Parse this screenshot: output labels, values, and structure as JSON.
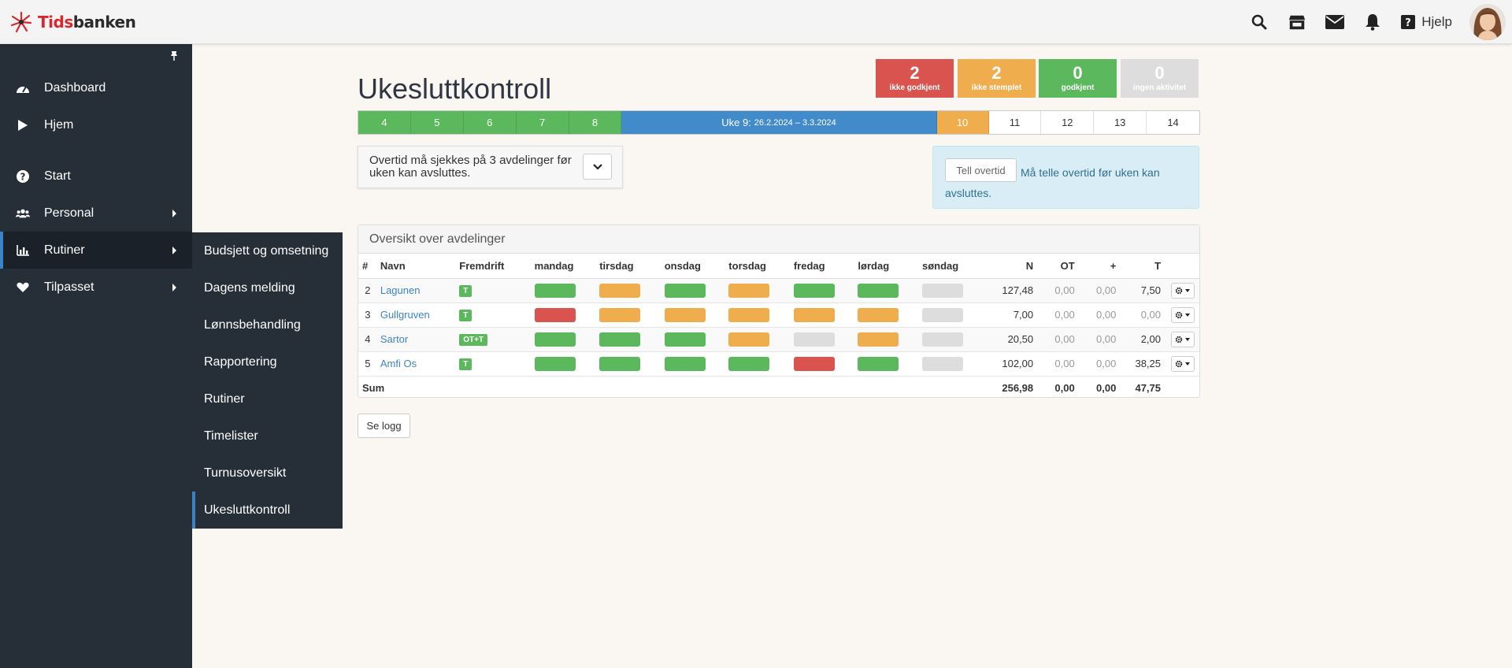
{
  "header": {
    "logo_part1": "Tids",
    "logo_part2": "banken",
    "help_label": "Hjelp"
  },
  "sidebar": {
    "items": [
      {
        "label": "Dashboard",
        "icon": "dashboard-icon"
      },
      {
        "label": "Hjem",
        "icon": "play-icon"
      },
      {
        "label": "Start",
        "icon": "question-icon"
      },
      {
        "label": "Personal",
        "icon": "users-icon"
      },
      {
        "label": "Rutiner",
        "icon": "bar-chart-icon"
      },
      {
        "label": "Tilpasset",
        "icon": "heart-icon"
      }
    ]
  },
  "submenu": {
    "items": [
      "Budsjett og omsetning",
      "Dagens melding",
      "Lønnsbehandling",
      "Rapportering",
      "Rutiner",
      "Timelister",
      "Turnusoversikt",
      "Ukesluttkontroll"
    ]
  },
  "page": {
    "title": "Ukesluttkontroll"
  },
  "status": [
    {
      "count": "2",
      "label": "ikke godkjent",
      "color": "#d9534f"
    },
    {
      "count": "2",
      "label": "ikke stemplet",
      "color": "#f0ad4e"
    },
    {
      "count": "0",
      "label": "godkjent",
      "color": "#5cb85c"
    },
    {
      "count": "0",
      "label": "ingen aktivitet",
      "color": "#dddddd"
    }
  ],
  "weeks": {
    "before": [
      "4",
      "5",
      "6",
      "7",
      "8"
    ],
    "current_label": "Uke 9:",
    "current_range": "26.2.2024 – 3.3.2024",
    "next": "10",
    "after": [
      "11",
      "12",
      "13",
      "14"
    ]
  },
  "overtid": {
    "text": "Overtid må sjekkes på 3 avdelinger før uken kan avsluttes."
  },
  "alert": {
    "button": "Tell overtid",
    "text": "Må telle overtid før uken kan avsluttes."
  },
  "panel": {
    "title": "Oversikt over avdelinger",
    "columns": [
      "#",
      "Navn",
      "Fremdrift",
      "mandag",
      "tirsdag",
      "onsdag",
      "torsdag",
      "fredag",
      "lørdag",
      "søndag",
      "N",
      "OT",
      "+",
      "T"
    ],
    "rows": [
      {
        "nr": "2",
        "name": "Lagunen",
        "progress": "T",
        "days": [
          "green",
          "orange",
          "green",
          "orange",
          "green",
          "green",
          "grey"
        ],
        "n": "127,48",
        "ot": "0,00",
        "plus": "0,00",
        "t": "7,50"
      },
      {
        "nr": "3",
        "name": "Gullgruven",
        "progress": "T",
        "days": [
          "red",
          "orange",
          "orange",
          "orange",
          "orange",
          "orange",
          "grey"
        ],
        "n": "7,00",
        "ot": "0,00",
        "plus": "0,00",
        "t": "0,00"
      },
      {
        "nr": "4",
        "name": "Sartor",
        "progress": "OT+T",
        "days": [
          "green",
          "green",
          "green",
          "orange",
          "grey",
          "orange",
          "grey"
        ],
        "n": "20,50",
        "ot": "0,00",
        "plus": "0,00",
        "t": "2,00"
      },
      {
        "nr": "5",
        "name": "Amfi Os",
        "progress": "T",
        "days": [
          "green",
          "green",
          "green",
          "green",
          "red",
          "green",
          "grey"
        ],
        "n": "102,00",
        "ot": "0,00",
        "plus": "0,00",
        "t": "38,25"
      }
    ],
    "sum": {
      "label": "Sum",
      "n": "256,98",
      "ot": "0,00",
      "plus": "0,00",
      "t": "47,75"
    }
  },
  "logg_button": "Se logg"
}
